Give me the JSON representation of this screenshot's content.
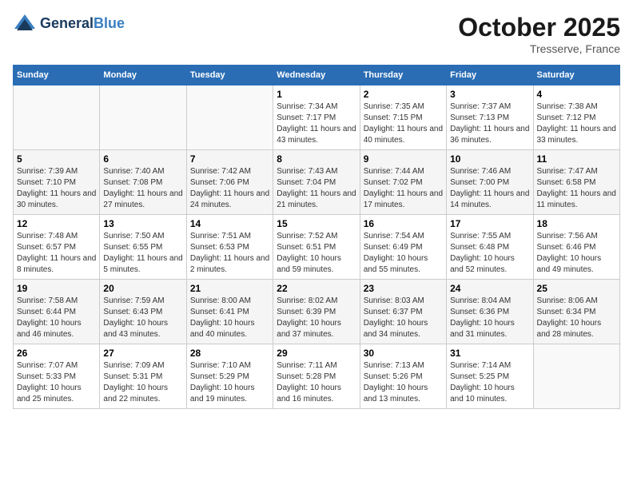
{
  "header": {
    "logo_line1": "General",
    "logo_line2": "Blue",
    "month": "October 2025",
    "location": "Tresserve, France"
  },
  "weekdays": [
    "Sunday",
    "Monday",
    "Tuesday",
    "Wednesday",
    "Thursday",
    "Friday",
    "Saturday"
  ],
  "weeks": [
    [
      {
        "day": "",
        "info": ""
      },
      {
        "day": "",
        "info": ""
      },
      {
        "day": "",
        "info": ""
      },
      {
        "day": "1",
        "info": "Sunrise: 7:34 AM\nSunset: 7:17 PM\nDaylight: 11 hours and 43 minutes."
      },
      {
        "day": "2",
        "info": "Sunrise: 7:35 AM\nSunset: 7:15 PM\nDaylight: 11 hours and 40 minutes."
      },
      {
        "day": "3",
        "info": "Sunrise: 7:37 AM\nSunset: 7:13 PM\nDaylight: 11 hours and 36 minutes."
      },
      {
        "day": "4",
        "info": "Sunrise: 7:38 AM\nSunset: 7:12 PM\nDaylight: 11 hours and 33 minutes."
      }
    ],
    [
      {
        "day": "5",
        "info": "Sunrise: 7:39 AM\nSunset: 7:10 PM\nDaylight: 11 hours and 30 minutes."
      },
      {
        "day": "6",
        "info": "Sunrise: 7:40 AM\nSunset: 7:08 PM\nDaylight: 11 hours and 27 minutes."
      },
      {
        "day": "7",
        "info": "Sunrise: 7:42 AM\nSunset: 7:06 PM\nDaylight: 11 hours and 24 minutes."
      },
      {
        "day": "8",
        "info": "Sunrise: 7:43 AM\nSunset: 7:04 PM\nDaylight: 11 hours and 21 minutes."
      },
      {
        "day": "9",
        "info": "Sunrise: 7:44 AM\nSunset: 7:02 PM\nDaylight: 11 hours and 17 minutes."
      },
      {
        "day": "10",
        "info": "Sunrise: 7:46 AM\nSunset: 7:00 PM\nDaylight: 11 hours and 14 minutes."
      },
      {
        "day": "11",
        "info": "Sunrise: 7:47 AM\nSunset: 6:58 PM\nDaylight: 11 hours and 11 minutes."
      }
    ],
    [
      {
        "day": "12",
        "info": "Sunrise: 7:48 AM\nSunset: 6:57 PM\nDaylight: 11 hours and 8 minutes."
      },
      {
        "day": "13",
        "info": "Sunrise: 7:50 AM\nSunset: 6:55 PM\nDaylight: 11 hours and 5 minutes."
      },
      {
        "day": "14",
        "info": "Sunrise: 7:51 AM\nSunset: 6:53 PM\nDaylight: 11 hours and 2 minutes."
      },
      {
        "day": "15",
        "info": "Sunrise: 7:52 AM\nSunset: 6:51 PM\nDaylight: 10 hours and 59 minutes."
      },
      {
        "day": "16",
        "info": "Sunrise: 7:54 AM\nSunset: 6:49 PM\nDaylight: 10 hours and 55 minutes."
      },
      {
        "day": "17",
        "info": "Sunrise: 7:55 AM\nSunset: 6:48 PM\nDaylight: 10 hours and 52 minutes."
      },
      {
        "day": "18",
        "info": "Sunrise: 7:56 AM\nSunset: 6:46 PM\nDaylight: 10 hours and 49 minutes."
      }
    ],
    [
      {
        "day": "19",
        "info": "Sunrise: 7:58 AM\nSunset: 6:44 PM\nDaylight: 10 hours and 46 minutes."
      },
      {
        "day": "20",
        "info": "Sunrise: 7:59 AM\nSunset: 6:43 PM\nDaylight: 10 hours and 43 minutes."
      },
      {
        "day": "21",
        "info": "Sunrise: 8:00 AM\nSunset: 6:41 PM\nDaylight: 10 hours and 40 minutes."
      },
      {
        "day": "22",
        "info": "Sunrise: 8:02 AM\nSunset: 6:39 PM\nDaylight: 10 hours and 37 minutes."
      },
      {
        "day": "23",
        "info": "Sunrise: 8:03 AM\nSunset: 6:37 PM\nDaylight: 10 hours and 34 minutes."
      },
      {
        "day": "24",
        "info": "Sunrise: 8:04 AM\nSunset: 6:36 PM\nDaylight: 10 hours and 31 minutes."
      },
      {
        "day": "25",
        "info": "Sunrise: 8:06 AM\nSunset: 6:34 PM\nDaylight: 10 hours and 28 minutes."
      }
    ],
    [
      {
        "day": "26",
        "info": "Sunrise: 7:07 AM\nSunset: 5:33 PM\nDaylight: 10 hours and 25 minutes."
      },
      {
        "day": "27",
        "info": "Sunrise: 7:09 AM\nSunset: 5:31 PM\nDaylight: 10 hours and 22 minutes."
      },
      {
        "day": "28",
        "info": "Sunrise: 7:10 AM\nSunset: 5:29 PM\nDaylight: 10 hours and 19 minutes."
      },
      {
        "day": "29",
        "info": "Sunrise: 7:11 AM\nSunset: 5:28 PM\nDaylight: 10 hours and 16 minutes."
      },
      {
        "day": "30",
        "info": "Sunrise: 7:13 AM\nSunset: 5:26 PM\nDaylight: 10 hours and 13 minutes."
      },
      {
        "day": "31",
        "info": "Sunrise: 7:14 AM\nSunset: 5:25 PM\nDaylight: 10 hours and 10 minutes."
      },
      {
        "day": "",
        "info": ""
      }
    ]
  ]
}
